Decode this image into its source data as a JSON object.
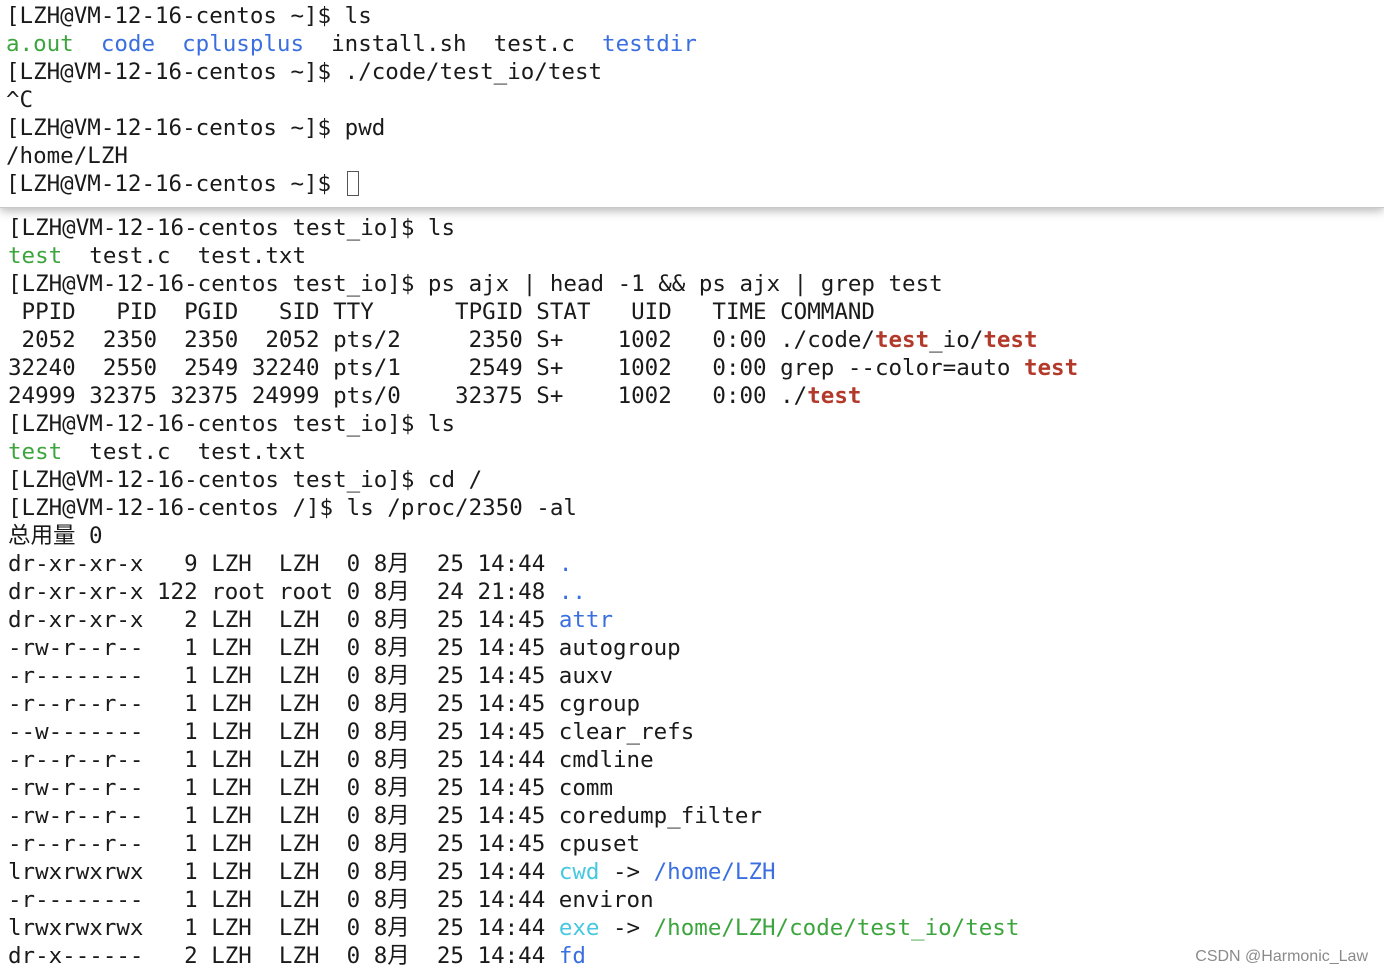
{
  "front_terminal": {
    "lines": [
      {
        "segments": [
          {
            "text": "[LZH@VM-12-16-centos ~]$ ls",
            "color": "plain"
          }
        ]
      },
      {
        "segments": [
          {
            "text": "a.out",
            "color": "green"
          },
          {
            "text": "  ",
            "color": "plain"
          },
          {
            "text": "code",
            "color": "blue"
          },
          {
            "text": "  ",
            "color": "plain"
          },
          {
            "text": "cplusplus",
            "color": "blue"
          },
          {
            "text": "  install.sh  test.c  ",
            "color": "plain"
          },
          {
            "text": "testdir",
            "color": "blue"
          }
        ]
      },
      {
        "segments": [
          {
            "text": "[LZH@VM-12-16-centos ~]$ ./code/test_io/test",
            "color": "plain"
          }
        ]
      },
      {
        "segments": [
          {
            "text": "^C",
            "color": "plain"
          }
        ]
      },
      {
        "segments": [
          {
            "text": "[LZH@VM-12-16-centos ~]$ pwd",
            "color": "plain"
          }
        ]
      },
      {
        "segments": [
          {
            "text": "/home/LZH",
            "color": "plain"
          }
        ]
      },
      {
        "segments": [
          {
            "text": "[LZH@VM-12-16-centos ~]$ ",
            "color": "plain"
          }
        ],
        "cursor": true
      }
    ]
  },
  "back_terminal": {
    "lines": [
      {
        "segments": [
          {
            "text": "[LZH@VM-12-16-centos test_io]$ ls",
            "color": "plain"
          }
        ]
      },
      {
        "segments": [
          {
            "text": "test",
            "color": "green"
          },
          {
            "text": "  test.c  test.txt",
            "color": "plain"
          }
        ]
      },
      {
        "segments": [
          {
            "text": "[LZH@VM-12-16-centos test_io]$ ps ajx | head -1 && ps ajx | grep test",
            "color": "plain"
          }
        ]
      },
      {
        "segments": [
          {
            "text": " PPID   PID  PGID   SID TTY      TPGID STAT   UID   TIME COMMAND",
            "color": "plain"
          }
        ]
      },
      {
        "segments": [
          {
            "text": " 2052  2350  2350  2052 pts/2     2350 S+    1002   0:00 ./code/",
            "color": "plain"
          },
          {
            "text": "test",
            "color": "red"
          },
          {
            "text": "_io/",
            "color": "plain"
          },
          {
            "text": "test",
            "color": "red"
          }
        ]
      },
      {
        "segments": [
          {
            "text": "32240  2550  2549 32240 pts/1     2549 S+    1002   0:00 grep --color=auto ",
            "color": "plain"
          },
          {
            "text": "test",
            "color": "red"
          }
        ]
      },
      {
        "segments": [
          {
            "text": "24999 32375 32375 24999 pts/0    32375 S+    1002   0:00 ./",
            "color": "plain"
          },
          {
            "text": "test",
            "color": "red"
          }
        ]
      },
      {
        "segments": [
          {
            "text": "[LZH@VM-12-16-centos test_io]$ ls",
            "color": "plain"
          }
        ]
      },
      {
        "segments": [
          {
            "text": "test",
            "color": "green"
          },
          {
            "text": "  test.c  test.txt",
            "color": "plain"
          }
        ]
      },
      {
        "segments": [
          {
            "text": "[LZH@VM-12-16-centos test_io]$ cd /",
            "color": "plain"
          }
        ]
      },
      {
        "segments": [
          {
            "text": "[LZH@VM-12-16-centos /]$ ls /proc/2350 -al",
            "color": "plain"
          }
        ]
      },
      {
        "segments": [
          {
            "text": "总用量 0",
            "color": "plain"
          }
        ]
      },
      {
        "segments": [
          {
            "text": "dr-xr-xr-x   9 LZH  LZH  0 8月  25 14:44 ",
            "color": "plain"
          },
          {
            "text": ".",
            "color": "blue"
          }
        ]
      },
      {
        "segments": [
          {
            "text": "dr-xr-xr-x 122 root root 0 8月  24 21:48 ",
            "color": "plain"
          },
          {
            "text": "..",
            "color": "blue"
          }
        ]
      },
      {
        "segments": [
          {
            "text": "dr-xr-xr-x   2 LZH  LZH  0 8月  25 14:45 ",
            "color": "plain"
          },
          {
            "text": "attr",
            "color": "blue"
          }
        ]
      },
      {
        "segments": [
          {
            "text": "-rw-r--r--   1 LZH  LZH  0 8月  25 14:45 autogroup",
            "color": "plain"
          }
        ]
      },
      {
        "segments": [
          {
            "text": "-r--------   1 LZH  LZH  0 8月  25 14:45 auxv",
            "color": "plain"
          }
        ]
      },
      {
        "segments": [
          {
            "text": "-r--r--r--   1 LZH  LZH  0 8月  25 14:45 cgroup",
            "color": "plain"
          }
        ]
      },
      {
        "segments": [
          {
            "text": "--w-------   1 LZH  LZH  0 8月  25 14:45 clear_refs",
            "color": "plain"
          }
        ]
      },
      {
        "segments": [
          {
            "text": "-r--r--r--   1 LZH  LZH  0 8月  25 14:44 cmdline",
            "color": "plain"
          }
        ]
      },
      {
        "segments": [
          {
            "text": "-rw-r--r--   1 LZH  LZH  0 8月  25 14:45 comm",
            "color": "plain"
          }
        ]
      },
      {
        "segments": [
          {
            "text": "-rw-r--r--   1 LZH  LZH  0 8月  25 14:45 coredump_filter",
            "color": "plain"
          }
        ]
      },
      {
        "segments": [
          {
            "text": "-r--r--r--   1 LZH  LZH  0 8月  25 14:45 cpuset",
            "color": "plain"
          }
        ]
      },
      {
        "segments": [
          {
            "text": "lrwxrwxrwx   1 LZH  LZH  0 8月  25 14:44 ",
            "color": "plain"
          },
          {
            "text": "cwd",
            "color": "cyan"
          },
          {
            "text": " -> ",
            "color": "plain"
          },
          {
            "text": "/home/LZH",
            "color": "blue"
          }
        ]
      },
      {
        "segments": [
          {
            "text": "-r--------   1 LZH  LZH  0 8月  25 14:44 environ",
            "color": "plain"
          }
        ]
      },
      {
        "segments": [
          {
            "text": "lrwxrwxrwx   1 LZH  LZH  0 8月  25 14:44 ",
            "color": "plain"
          },
          {
            "text": "exe",
            "color": "cyan"
          },
          {
            "text": " -> ",
            "color": "plain"
          },
          {
            "text": "/home/LZH/code/test_io/test",
            "color": "green"
          }
        ]
      },
      {
        "segments": [
          {
            "text": "dr-x------   2 LZH  LZH  0 8月  25 14:44 ",
            "color": "plain"
          },
          {
            "text": "fd",
            "color": "blue"
          }
        ]
      }
    ]
  },
  "watermark": "CSDN @Harmonic_Law",
  "colors": {
    "plain": "#1a1a1a",
    "green": "#3da53d",
    "blue": "#3b6fe0",
    "cyan": "#46c8e0",
    "red": "#b33a2a"
  }
}
